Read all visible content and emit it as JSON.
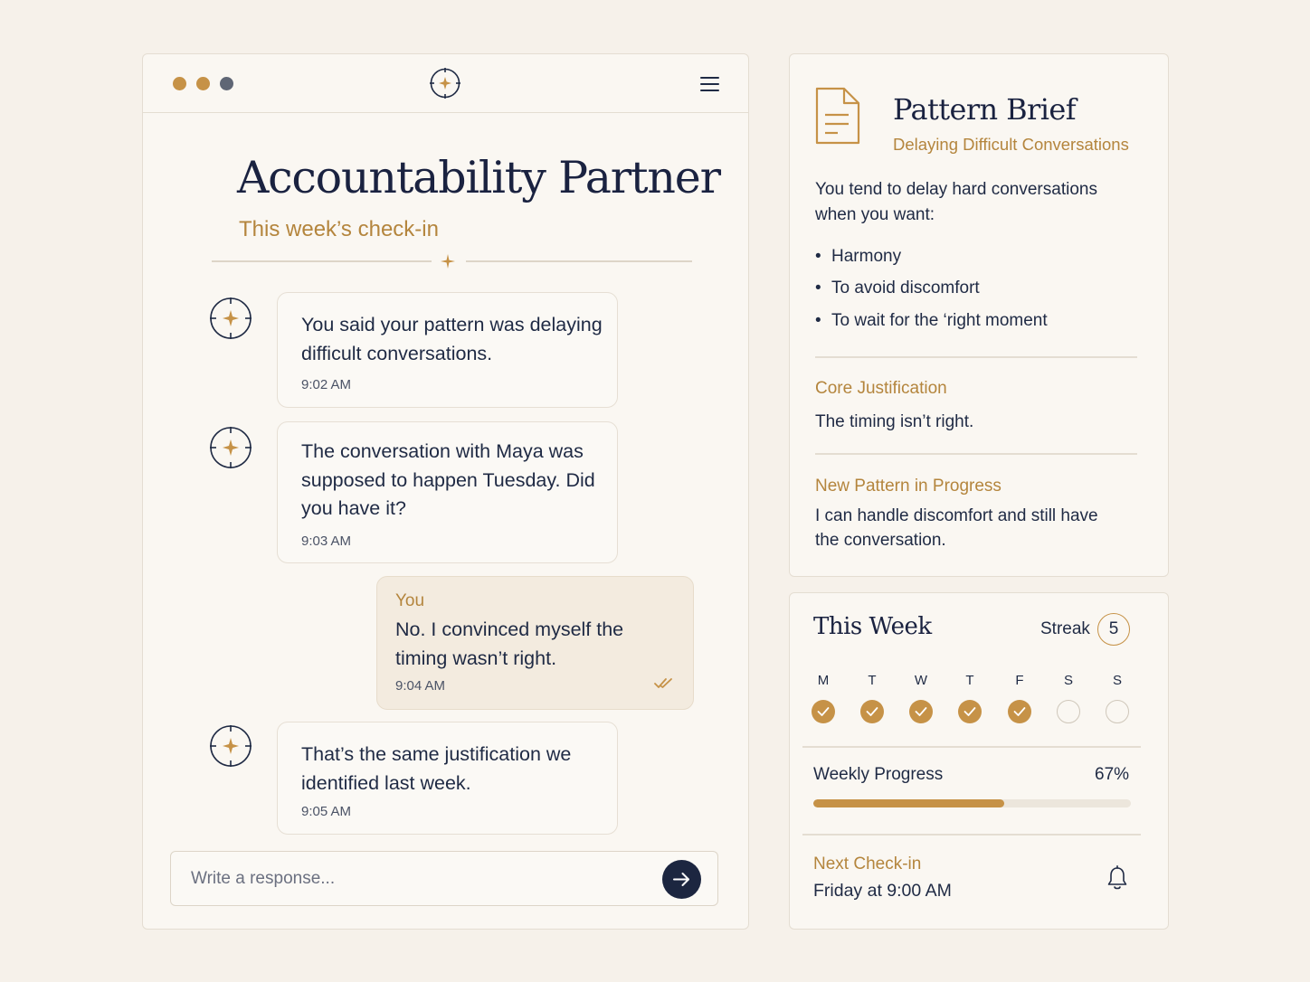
{
  "chat": {
    "title": "Accountability Partner",
    "subtitle": "This week’s check-in",
    "messages": [
      {
        "sender": "partner",
        "text": "You said your pattern was delaying difficult conversations.",
        "time": "9:02 AM"
      },
      {
        "sender": "partner",
        "text": "The conversation with Maya was supposed to happen Tuesday. Did you have it?",
        "time": "9:03 AM"
      },
      {
        "sender": "You",
        "text": "No. I convinced myself the timing wasn’t right.",
        "time": "9:04 AM"
      },
      {
        "sender": "partner",
        "text": "That’s the same justification we identified last week.",
        "time": "9:05 AM"
      }
    ],
    "composer": {
      "placeholder": "Write a response..."
    }
  },
  "brief": {
    "title": "Pattern Brief",
    "subtitle": "Delaying Difficult Conversations",
    "intro": "You tend to delay hard conversations when you want:",
    "reasons": [
      "Harmony",
      "To avoid discomfort",
      "To wait for the ‘right moment"
    ],
    "core_heading": "Core Justification",
    "core_body": "The timing isn’t right.",
    "new_heading": "New Pattern in Progress",
    "new_body": "I can handle discomfort and still have the conversation."
  },
  "week": {
    "title": "This Week",
    "streak_label": "Streak",
    "streak_value": "5",
    "days": [
      {
        "letter": "M",
        "done": true
      },
      {
        "letter": "T",
        "done": true
      },
      {
        "letter": "W",
        "done": true
      },
      {
        "letter": "T",
        "done": true
      },
      {
        "letter": "F",
        "done": true
      },
      {
        "letter": "S",
        "done": false
      },
      {
        "letter": "S",
        "done": false
      }
    ],
    "progress_label": "Weekly Progress",
    "progress_text": "67%",
    "progress_value": 0.6,
    "next_label": "Next Check-in",
    "next_value": "Friday at 9:00 AM"
  },
  "colors": {
    "accent": "#c69247",
    "navy": "#1c2640",
    "background": "#f6f1ea"
  }
}
